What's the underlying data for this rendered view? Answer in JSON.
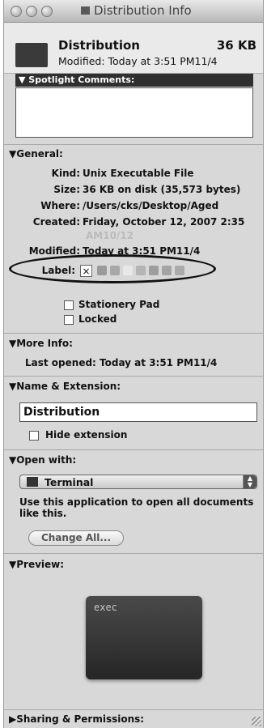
{
  "window": {
    "title": "Distribution Info"
  },
  "header": {
    "name": "Distribution",
    "size": "36 KB",
    "modified": "Modified: Today at 3:51 PM11/4"
  },
  "spotlight": {
    "label": "Spotlight Comments:"
  },
  "general": {
    "label": "General:",
    "rows": [
      {
        "label": "Kind:",
        "value": "Unix Executable File"
      },
      {
        "label": "Size:",
        "value": "36 KB on disk (35,573 bytes)"
      },
      {
        "label": "Where:",
        "value": "/Users/cks/Desktop/Aged"
      },
      {
        "label": "Created:",
        "value": "Friday, October 12, 2007 2:35"
      },
      {
        "label": "Modified:",
        "value": "Today at 3:51 PM11/4"
      }
    ],
    "created_overflow": "AM10/12",
    "label_label": "Label:",
    "label_none": "×",
    "label_colors": [
      "#9a9a9a",
      "#a8a8a8",
      "#e8e8e8",
      "#b4b4b4",
      "#9e9e9e",
      "#a4a4a4",
      "#aaaaaa"
    ],
    "stationery": "Stationery Pad",
    "locked": "Locked"
  },
  "more_info": {
    "label": "More Info:",
    "last_opened": "Last opened: Today at 3:51 PM11/4"
  },
  "name_ext": {
    "label": "Name & Extension:",
    "value": "Distribution",
    "hide_ext": "Hide extension"
  },
  "open_with": {
    "label": "Open with:",
    "app": "Terminal",
    "description": "Use this application to open all documents like this.",
    "change_all": "Change All..."
  },
  "preview": {
    "label": "Preview:",
    "text": "exec"
  },
  "sharing": {
    "label": "Sharing & Permissions:"
  }
}
